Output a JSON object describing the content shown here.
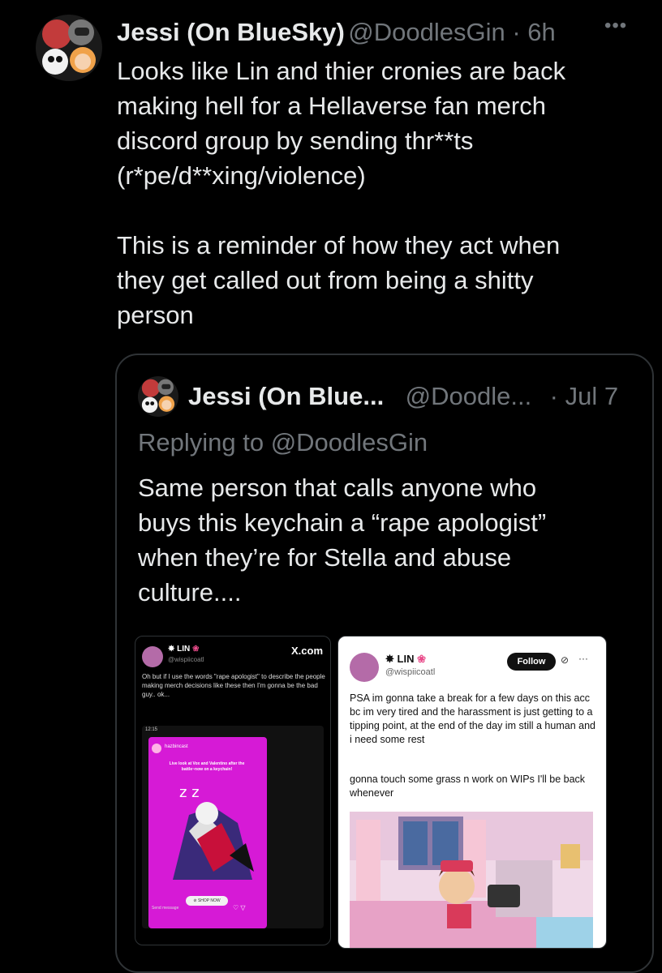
{
  "tweet": {
    "author_name": "Jessi (On BlueSky)",
    "handle_time": "@DoodlesGin · 6h",
    "more": "•••",
    "text": "Looks like Lin and thier cronies are back\nmaking hell for a Hellaverse fan merch\ndiscord group by sending thr**ts\n(r*pe/d**xing/violence)\n\nThis is a reminder of how they act when\nthey get called out from being a shitty\nperson"
  },
  "quote": {
    "author_name": "Jessi (On Blue...",
    "handle": "@Doodle...",
    "time": "· Jul 7",
    "replying": "Replying to @DoodlesGin",
    "text": "Same person that calls anyone who\nbuys this keychain a “rape apologist”\nwhen they’re for Stella and abuse\nculture....",
    "left_image": {
      "name": "LIN",
      "handle": "@wispiicoatl",
      "brand": "X.com",
      "text": "Oh but if I use the words \"rape apologist\" to describe the people making merch decisions like these then I'm gonna be the bad guy.. ok...",
      "status_time": "12:15",
      "story_user": "hazbincast",
      "story_caption": "Live look at Vox and Valentino after the battle~now on a keychain!",
      "shop_button": "SHOP NOW",
      "send_message": "Send message"
    },
    "right_image": {
      "name": "LIN",
      "handle": "@wispiicoatl",
      "follow": "Follow",
      "text1": "PSA im gonna take a break for a few days on this acc bc im very tired and the harassment is just getting to a tipping point, at the end of the day im still a human and i need some rest",
      "text2": "gonna touch some grass n work on WIPs I'll be back whenever"
    }
  },
  "colors": {
    "background": "#000000",
    "text": "#e7e9ea",
    "muted": "#71767b",
    "border": "#2f3336",
    "magenta": "#d61ad6"
  }
}
